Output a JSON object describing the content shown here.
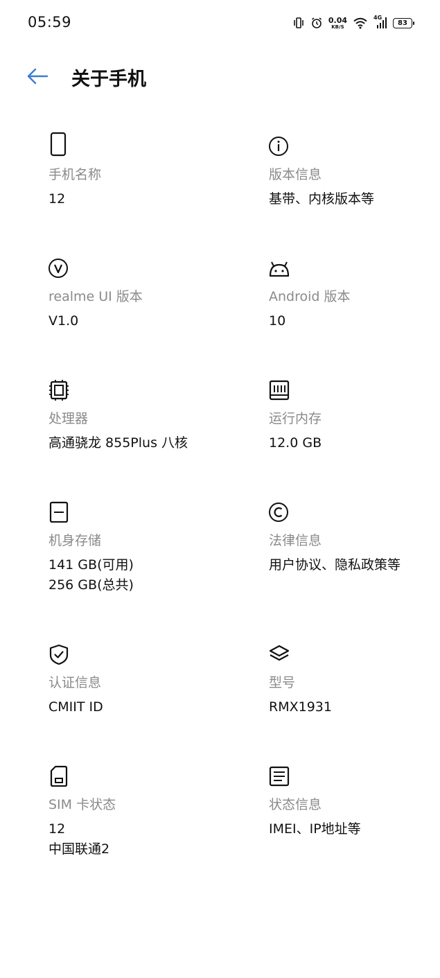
{
  "status_bar": {
    "time": "05:59",
    "net_speed_value": "0.04",
    "net_speed_unit": "KB/S",
    "network_type": "4G",
    "battery": "83",
    "icons": [
      "vibrate-icon",
      "alarm-icon",
      "wifi-icon",
      "signal-icon",
      "battery-icon"
    ]
  },
  "header": {
    "back_icon": "arrow-left-icon",
    "title": "关于手机"
  },
  "accent_color": "#3a7bd5",
  "items": [
    {
      "id": "phone-name",
      "icon": "phone-icon",
      "label": "手机名称",
      "value": "12"
    },
    {
      "id": "version-info",
      "icon": "info-icon",
      "label": "版本信息",
      "value": "基带、内核版本等"
    },
    {
      "id": "realme-ui-version",
      "icon": "v-circle-icon",
      "label": "realme UI 版本",
      "value": "V1.0"
    },
    {
      "id": "android-version",
      "icon": "android-icon",
      "label": "Android 版本",
      "value": "10"
    },
    {
      "id": "processor",
      "icon": "chip-icon",
      "label": "处理器",
      "value": "高通骁龙 855Plus 八核"
    },
    {
      "id": "ram",
      "icon": "memory-icon",
      "label": "运行内存",
      "value": "12.0 GB"
    },
    {
      "id": "storage",
      "icon": "storage-icon",
      "label": "机身存储",
      "value": "141 GB(可用)",
      "value2": "256 GB(总共)"
    },
    {
      "id": "legal-info",
      "icon": "copyright-icon",
      "label": "法律信息",
      "value": "用户协议、隐私政策等"
    },
    {
      "id": "certification",
      "icon": "shield-check-icon",
      "label": "认证信息",
      "value": "CMIIT ID"
    },
    {
      "id": "model",
      "icon": "layers-icon",
      "label": "型号",
      "value": "RMX1931"
    },
    {
      "id": "sim-status",
      "icon": "sim-card-icon",
      "label": "SIM 卡状态",
      "value": "12",
      "value2": "中国联通2"
    },
    {
      "id": "status-info",
      "icon": "document-icon",
      "label": "状态信息",
      "value": "IMEI、IP地址等"
    }
  ]
}
